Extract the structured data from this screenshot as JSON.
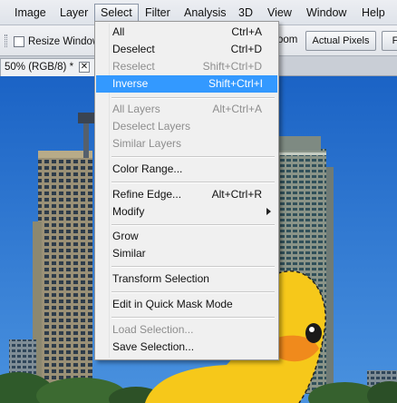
{
  "menubar": {
    "items": [
      {
        "label": "Image"
      },
      {
        "label": "Layer"
      },
      {
        "label": "Select"
      },
      {
        "label": "Filter"
      },
      {
        "label": "Analysis"
      },
      {
        "label": "3D"
      },
      {
        "label": "View"
      },
      {
        "label": "Window"
      },
      {
        "label": "Help"
      }
    ],
    "active": "Select"
  },
  "options_bar": {
    "resize_windows_label": "Resize Windows T",
    "resize_windows_checked": false,
    "zoom_fragment": "oom",
    "actual_pixels_label": "Actual Pixels",
    "next_button_label": "F"
  },
  "document_tab": {
    "title": "50% (RGB/8) *",
    "close_glyph": "✕"
  },
  "select_menu": {
    "items": [
      {
        "label": "All",
        "shortcut": "Ctrl+A",
        "enabled": true
      },
      {
        "label": "Deselect",
        "shortcut": "Ctrl+D",
        "enabled": true
      },
      {
        "label": "Reselect",
        "shortcut": "Shift+Ctrl+D",
        "enabled": false
      },
      {
        "label": "Inverse",
        "shortcut": "Shift+Ctrl+I",
        "enabled": true,
        "highlighted": true
      },
      {
        "label": "All Layers",
        "shortcut": "Alt+Ctrl+A",
        "enabled": false
      },
      {
        "label": "Deselect Layers",
        "shortcut": "",
        "enabled": false
      },
      {
        "label": "Similar Layers",
        "shortcut": "",
        "enabled": false
      },
      {
        "label": "Color Range...",
        "shortcut": "",
        "enabled": true
      },
      {
        "label": "Refine Edge...",
        "shortcut": "Alt+Ctrl+R",
        "enabled": true
      },
      {
        "label": "Modify",
        "shortcut": "",
        "enabled": true,
        "submenu": true
      },
      {
        "label": "Grow",
        "shortcut": "",
        "enabled": true
      },
      {
        "label": "Similar",
        "shortcut": "",
        "enabled": true
      },
      {
        "label": "Transform Selection",
        "shortcut": "",
        "enabled": true
      },
      {
        "label": "Edit in Quick Mask Mode",
        "shortcut": "",
        "enabled": true
      },
      {
        "label": "Load Selection...",
        "shortcut": "",
        "enabled": false
      },
      {
        "label": "Save Selection...",
        "shortcut": "",
        "enabled": true
      }
    ]
  },
  "colors": {
    "highlight": "#3399ff",
    "sky": "#1f6fd0",
    "duck": "#f6c81a"
  }
}
